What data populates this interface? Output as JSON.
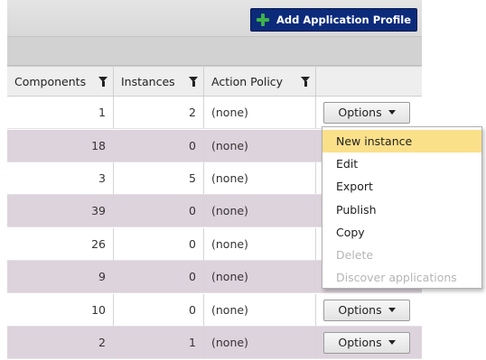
{
  "toolbar": {
    "add_label": "Add Application Profile"
  },
  "columns": [
    "Components",
    "Instances",
    "Action Policy"
  ],
  "rows": [
    {
      "components": "1",
      "instances": "2",
      "policy": "(none)"
    },
    {
      "components": "18",
      "instances": "0",
      "policy": "(none)"
    },
    {
      "components": "3",
      "instances": "5",
      "policy": "(none)"
    },
    {
      "components": "39",
      "instances": "0",
      "policy": "(none)"
    },
    {
      "components": "26",
      "instances": "0",
      "policy": "(none)"
    },
    {
      "components": "9",
      "instances": "0",
      "policy": "(none)"
    },
    {
      "components": "10",
      "instances": "0",
      "policy": "(none)"
    },
    {
      "components": "2",
      "instances": "1",
      "policy": "(none)"
    }
  ],
  "options_label": "Options",
  "menu": [
    {
      "label": "New instance",
      "state": "highlighted"
    },
    {
      "label": "Edit",
      "state": "enabled"
    },
    {
      "label": "Export",
      "state": "enabled"
    },
    {
      "label": "Publish",
      "state": "enabled"
    },
    {
      "label": "Copy",
      "state": "enabled"
    },
    {
      "label": "Delete",
      "state": "disabled"
    },
    {
      "label": "Discover applications",
      "state": "disabled"
    }
  ],
  "colors": {
    "accent": "#0c2a7a",
    "row_alt": "#ddd3dc",
    "menu_highlight": "#fbe08a",
    "plus_green": "#3db34a"
  },
  "icons": {
    "add": "plus-icon",
    "filter": "filter-icon",
    "dropdown": "caret-down-icon"
  }
}
